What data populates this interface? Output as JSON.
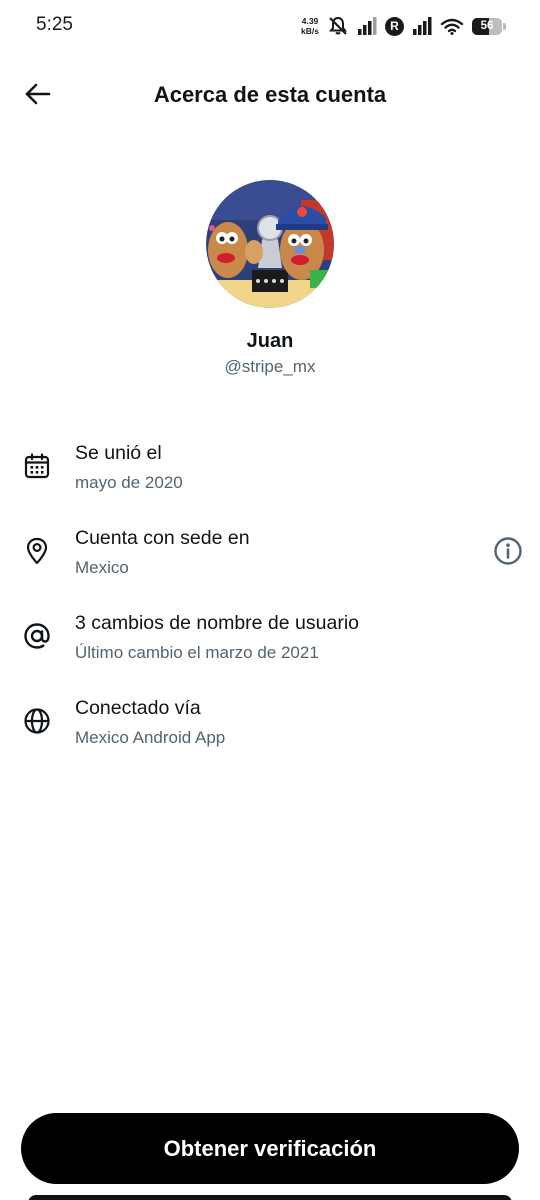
{
  "status_bar": {
    "time": "5:25",
    "net_speed_value": "4.39",
    "net_speed_unit": "kB/s",
    "carrier_badge": "R",
    "battery_level": "56",
    "battery_percent": 56,
    "icons": [
      "mute-vibrate-off-icon",
      "signal-icon",
      "roaming-r-icon",
      "signal-icon",
      "wifi-icon",
      "battery-icon"
    ]
  },
  "header": {
    "title": "Acerca de esta cuenta",
    "back_icon": "arrow-left-icon"
  },
  "profile": {
    "name": "Juan",
    "handle": "@stripe_mx"
  },
  "info": [
    {
      "icon": "calendar-icon",
      "title": "Se unió el",
      "subtitle": "mayo de 2020"
    },
    {
      "icon": "location-pin-icon",
      "title": "Cuenta con sede en",
      "subtitle": "Mexico",
      "action_icon": "info-circle-icon"
    },
    {
      "icon": "at-sign-icon",
      "title": "3 cambios de nombre de usuario",
      "subtitle": "Último cambio el marzo de 2021"
    },
    {
      "icon": "globe-icon",
      "title": "Conectado vía",
      "subtitle": "Mexico Android App"
    }
  ],
  "cta": {
    "label": "Obtener verificación"
  },
  "colors": {
    "text_primary": "#0f1419",
    "text_secondary": "#536471",
    "button_bg": "#000000",
    "button_text": "#ffffff"
  }
}
